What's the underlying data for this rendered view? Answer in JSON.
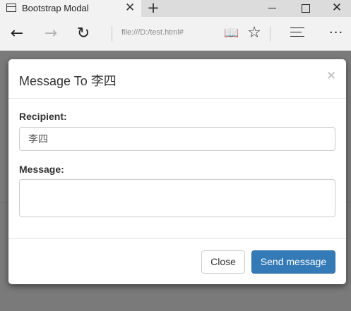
{
  "browser": {
    "tab_title": "Bootstrap Modal",
    "tab_close": "✕",
    "new_tab": "+",
    "address": "file:///D:/test.html#",
    "window_close": "✕",
    "more": "···",
    "icons": [
      "tab-page-icon",
      "back-arrow-icon",
      "forward-arrow-icon",
      "refresh-icon",
      "reading-view-icon",
      "favorite-star-icon",
      "hub-icon",
      "more-icon",
      "minimize-icon",
      "maximize-icon",
      "close-icon"
    ]
  },
  "modal": {
    "title": "Message To 李四",
    "close_glyph": "×",
    "recipient_label": "Recipient:",
    "recipient_value": "李四",
    "message_label": "Message:",
    "message_value": "",
    "close_button": "Close",
    "send_button": "Send message"
  },
  "colors": {
    "primary": "#337ab7",
    "backdrop": "#7a7a7a"
  }
}
